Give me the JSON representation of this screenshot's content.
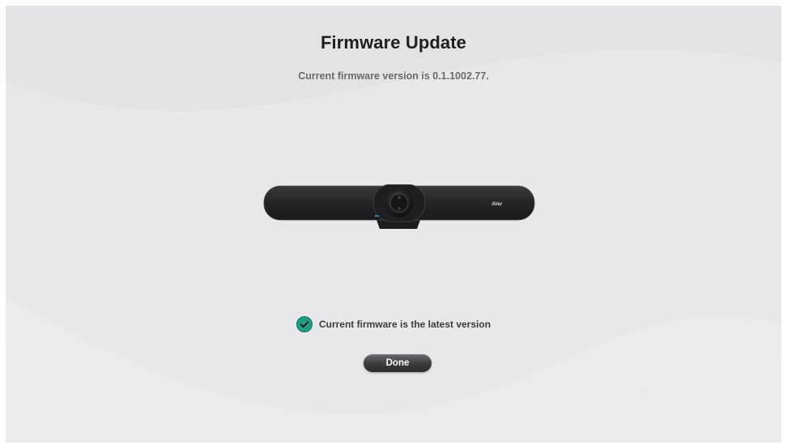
{
  "page": {
    "title": "Firmware Update",
    "subtitle": "Current firmware version is 0.1.1002.77."
  },
  "device": {
    "brand_mark": "AVer",
    "icon": "video-bar-camera-image"
  },
  "status": {
    "icon": "check-circle-icon",
    "text": "Current firmware is the latest version",
    "color": "#1f9e86"
  },
  "actions": {
    "done_label": "Done"
  },
  "colors": {
    "background": "#e8e7e9",
    "title": "#1f1f1f",
    "subtitle": "#6b6b6b",
    "button": "#3b3b3b",
    "device": "#2a2a2c"
  }
}
